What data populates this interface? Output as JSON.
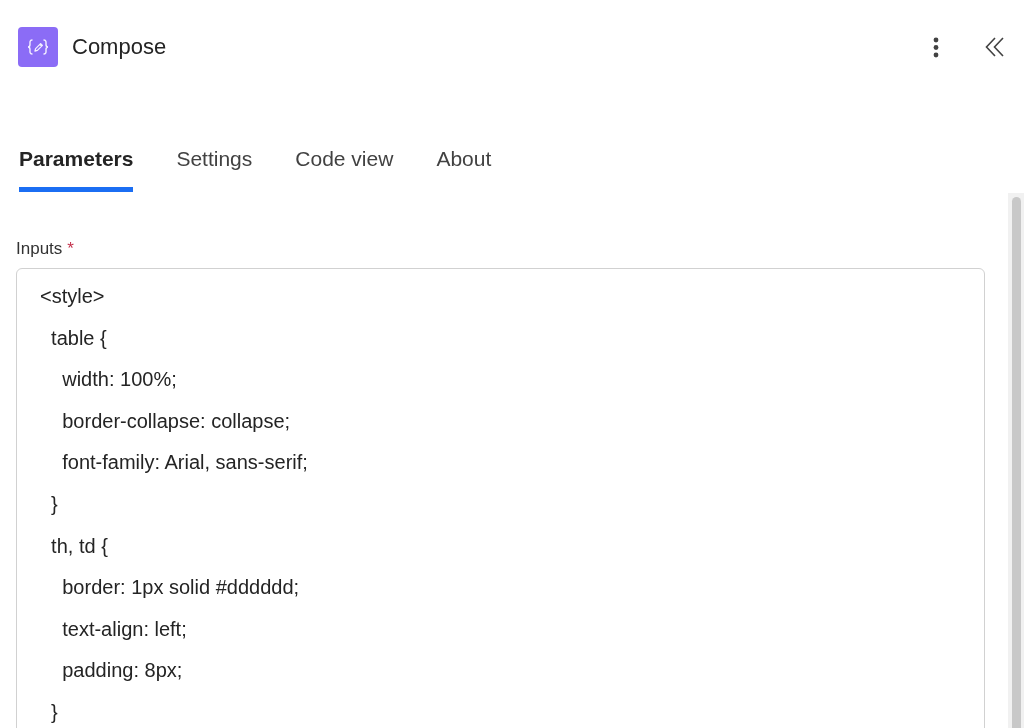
{
  "header": {
    "title": "Compose"
  },
  "tabs": [
    {
      "label": "Parameters",
      "selected": true
    },
    {
      "label": "Settings",
      "selected": false
    },
    {
      "label": "Code view",
      "selected": false
    },
    {
      "label": "About",
      "selected": false
    }
  ],
  "inputs": {
    "label": "Inputs",
    "required_mark": "*",
    "lines": [
      "<style>",
      "  table {",
      "    width: 100%;",
      "    border-collapse: collapse;",
      "    font-family: Arial, sans-serif;",
      "  }",
      "  th, td {",
      "    border: 1px solid #dddddd;",
      "    text-align: left;",
      "    padding: 8px;",
      "  }"
    ]
  }
}
